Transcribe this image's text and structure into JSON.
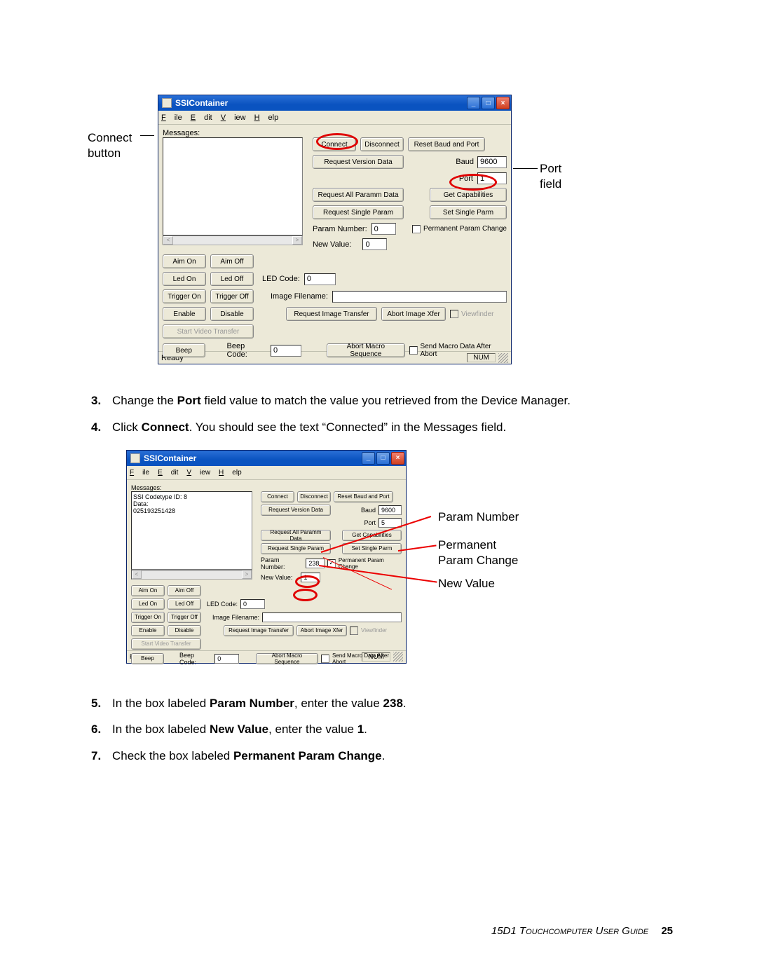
{
  "callouts": {
    "connect_button": "Connect\nbutton",
    "port_field": "Port\nfield",
    "param_number": "Param Number",
    "permanent_param_change": "Permanent\nParam Change",
    "new_value": "New Value"
  },
  "app": {
    "title": "SSIContainer",
    "menu": {
      "file": "File",
      "edit": "Edit",
      "view": "View",
      "help": "Help"
    },
    "labels": {
      "messages": "Messages:",
      "param_number": "Param Number:",
      "new_value": "New Value:",
      "led_code": "LED Code:",
      "image_filename": "Image Filename:",
      "beep_code": "Beep Code:",
      "baud": "Baud",
      "port": "Port"
    },
    "buttons": {
      "connect": "Connect",
      "disconnect": "Disconnect",
      "reset_baud_port": "Reset Baud and Port",
      "req_version": "Request Version Data",
      "req_all_param": "Request All Paramm Data",
      "get_caps": "Get Capabilities",
      "req_single_param": "Request Single Param",
      "set_single_parm": "Set Single Parm",
      "aim_on": "Aim On",
      "aim_off": "Aim Off",
      "led_on": "Led On",
      "led_off": "Led Off",
      "trigger_on": "Trigger On",
      "trigger_off": "Trigger Off",
      "enable": "Enable",
      "disable": "Disable",
      "start_video": "Start Video Transfer",
      "beep": "Beep",
      "req_image": "Request Image Transfer",
      "abort_image": "Abort Image Xfer",
      "abort_macro": "Abort Macro Sequence"
    },
    "checks": {
      "perm_param": "Permanent Param Change",
      "viewfinder": "Viewfinder",
      "send_macro": "Send Macro Data After Abort"
    },
    "status": {
      "ready": "Ready",
      "num": "NUM"
    }
  },
  "fig1": {
    "baud": "9600",
    "port": "1",
    "param_number": "0",
    "new_value": "0",
    "led_code": "0",
    "beep_code": "0",
    "messages": "",
    "perm_checked": false
  },
  "fig2": {
    "baud": "9600",
    "port": "5",
    "param_number": "238",
    "new_value": "1",
    "led_code": "0",
    "beep_code": "0",
    "messages": "SSI Codetype ID: 8\nData:\n025193251428",
    "perm_checked": true
  },
  "steps": {
    "s3": {
      "num": "3.",
      "pre": "Change the ",
      "b1": "Port",
      "post": " field value to match the value you retrieved from the Device Manager."
    },
    "s4": {
      "num": "4.",
      "pre": "Click ",
      "b1": "Connect",
      "post": ". You should see the text “Connected” in the Messages field."
    },
    "s5": {
      "num": "5.",
      "pre": "In the box labeled ",
      "b1": "Param Number",
      "mid": ", enter the value ",
      "b2": "238",
      "post": "."
    },
    "s6": {
      "num": "6.",
      "pre": "In the box labeled ",
      "b1": "New Value",
      "mid": ", enter the value ",
      "b2": "1",
      "post": "."
    },
    "s7": {
      "num": "7.",
      "pre": "Check the box labeled ",
      "b1": "Permanent Param Change",
      "post": "."
    }
  },
  "footer": {
    "text": "15D1 Touchcomputer User Guide",
    "page": "25"
  }
}
